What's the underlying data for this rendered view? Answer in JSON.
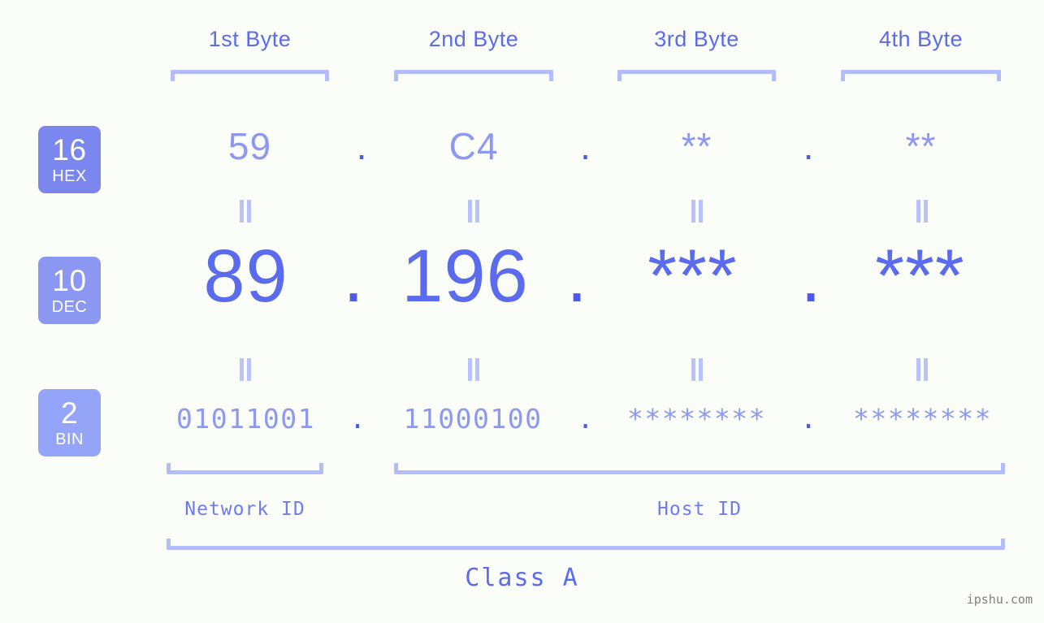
{
  "page": {
    "background": "#fbfdf8",
    "accent_strong": "#4b5ae8",
    "accent": "#5b6bed",
    "accent_mid": "#8d99f0",
    "accent_light": "#b4bdfb"
  },
  "byte_headers": [
    {
      "label": "1st Byte"
    },
    {
      "label": "2nd Byte"
    },
    {
      "label": "3rd Byte"
    },
    {
      "label": "4th Byte"
    }
  ],
  "bases": [
    {
      "id": "hex",
      "number": "16",
      "name": "HEX",
      "color": "#7b86ee"
    },
    {
      "id": "dec",
      "number": "10",
      "name": "DEC",
      "color": "#8c97f2"
    },
    {
      "id": "bin",
      "number": "2",
      "name": "BIN",
      "color": "#94a4f8"
    }
  ],
  "rows": {
    "hex": {
      "values": [
        "59",
        "C4",
        "**",
        "**"
      ],
      "separators": [
        ".",
        ".",
        "."
      ]
    },
    "dec": {
      "values": [
        "89",
        "196",
        "***",
        "***"
      ],
      "separators": [
        ".",
        ".",
        "."
      ]
    },
    "bin": {
      "values": [
        "01011001",
        "11000100",
        "********",
        "********"
      ],
      "separators": [
        ".",
        ".",
        "."
      ]
    }
  },
  "segments": [
    {
      "id": "network",
      "label": "Network ID"
    },
    {
      "id": "host",
      "label": "Host ID"
    }
  ],
  "class": {
    "label": "Class A"
  },
  "watermark": {
    "text": "ipshu.com"
  }
}
